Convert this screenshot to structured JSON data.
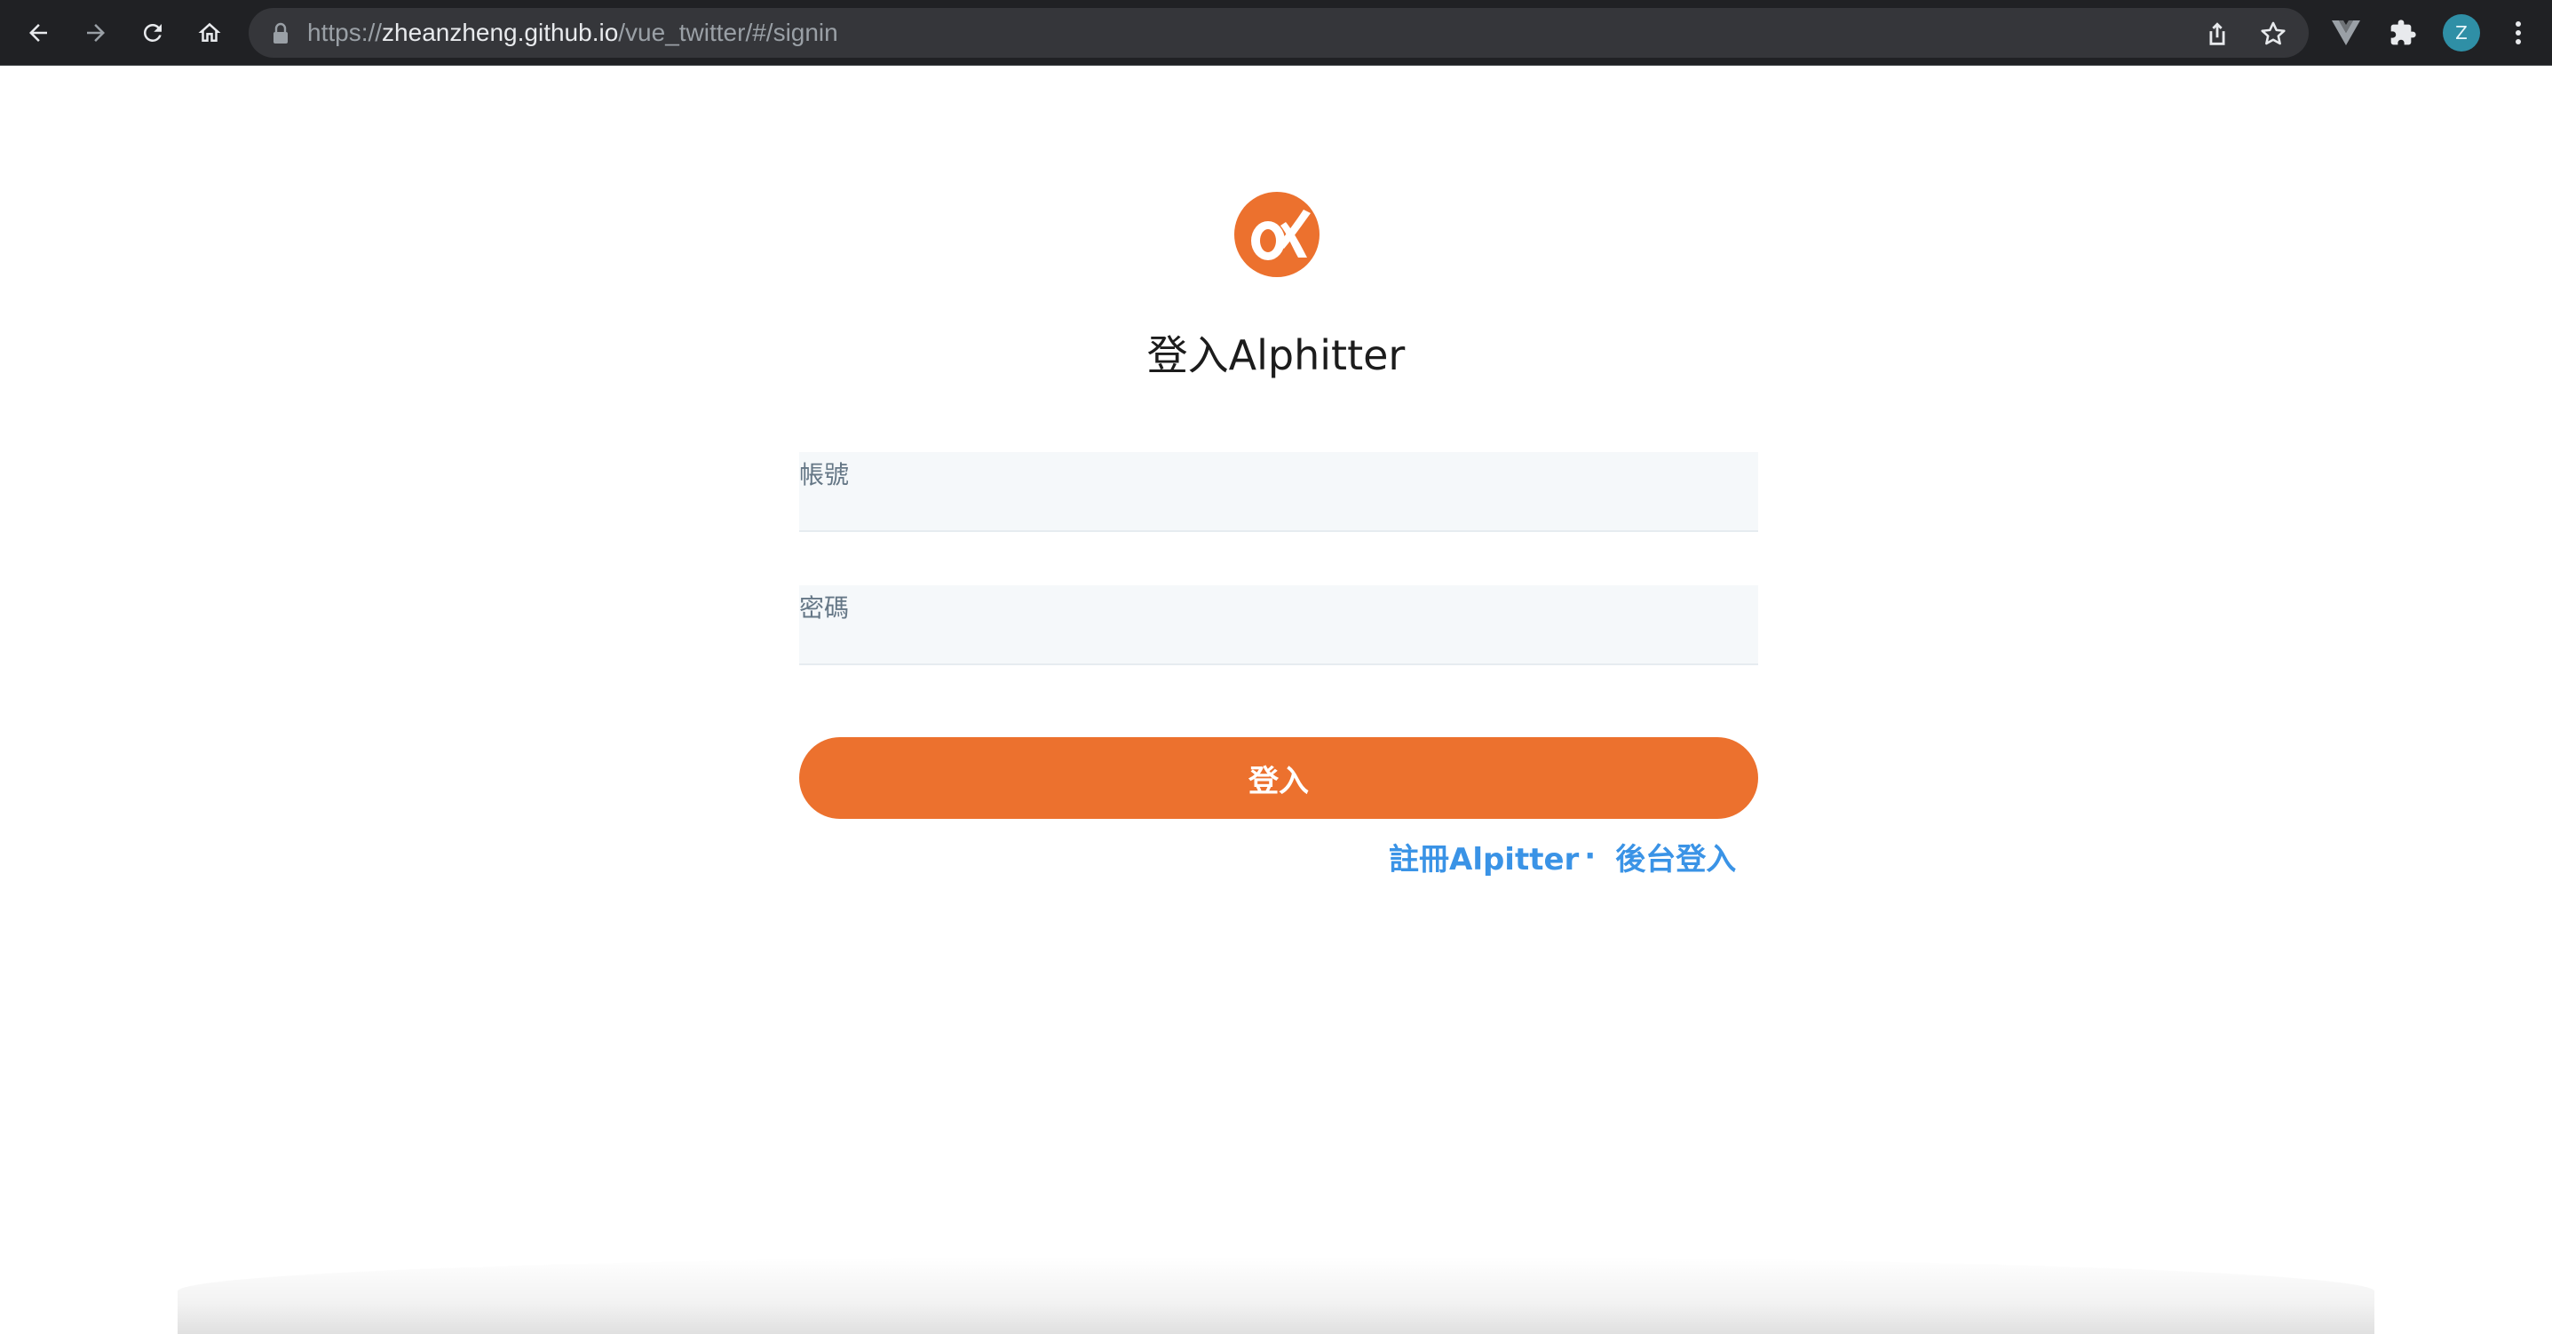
{
  "browser": {
    "url_scheme": "https://",
    "url_host": "zheanzheng.github.io",
    "url_path": "/vue_twitter/#/signin",
    "profile_initial": "Z",
    "icons": {
      "back": "arrow-left-icon",
      "forward": "arrow-right-icon",
      "reload": "reload-icon",
      "home": "home-icon",
      "lock": "lock-icon",
      "share": "share-icon",
      "bookmark": "star-icon",
      "vue_devtools": "vue-icon",
      "extensions": "puzzle-icon",
      "menu": "kebab-menu-icon"
    }
  },
  "signin": {
    "logo_icon": "alpha-logo-icon",
    "title": "登入Alphitter",
    "account_label": "帳號",
    "password_label": "密碼",
    "submit_label": "登入",
    "register_link": "註冊Alpitter",
    "separator": "·",
    "admin_link": "後台登入"
  },
  "colors": {
    "accent": "#ec712e",
    "link": "#3a93e6",
    "input_bg": "#f5f8fa",
    "chrome_bg": "#202124"
  }
}
